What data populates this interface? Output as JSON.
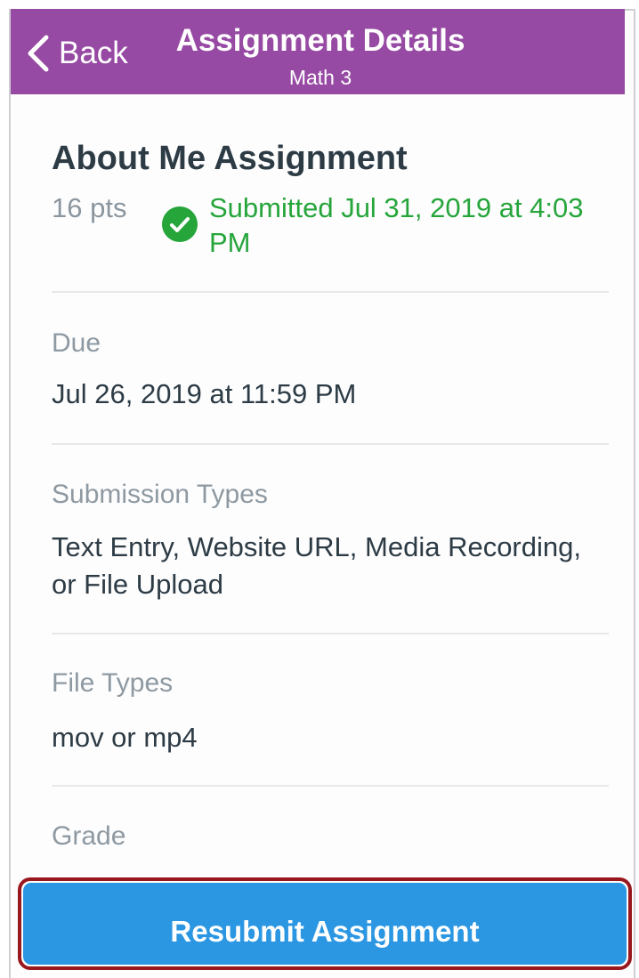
{
  "navbar": {
    "back_label": "Back",
    "title": "Assignment Details",
    "subtitle": "Math 3",
    "color": "#974aa3",
    "back_icon": "chevron-left-icon"
  },
  "assignment": {
    "name": "About Me Assignment",
    "points": "16 pts",
    "status_icon": "check-circle-icon",
    "status_color": "#26a53b",
    "submitted": "Submitted Jul 31, 2019 at 4:03 PM"
  },
  "details": {
    "due_label": "Due",
    "due_value": "Jul 26, 2019 at 11:59 PM",
    "submission_types_label": "Submission Types",
    "submission_types_value": "Text Entry, Website URL, Media Recording, or File Upload",
    "file_types_label": "File Types",
    "file_types_value": "mov or mp4",
    "grade_label": "Grade"
  },
  "actions": {
    "resubmit_label": "Resubmit Assignment",
    "button_color": "#2b96e2",
    "highlight_color": "#99181e"
  }
}
